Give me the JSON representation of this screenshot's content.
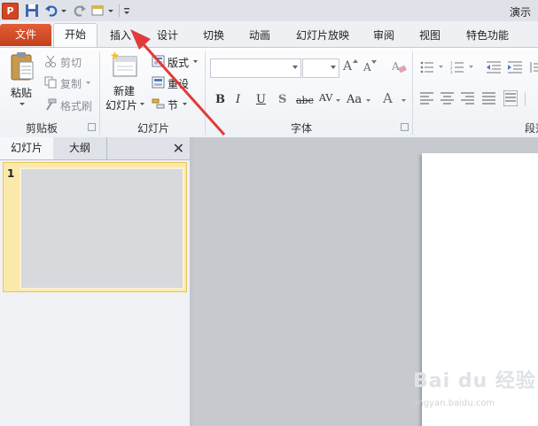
{
  "title_bar": {
    "app_logo": "P",
    "title": "演示"
  },
  "tabs": [
    "文件",
    "开始",
    "插入",
    "设计",
    "切换",
    "动画",
    "幻灯片放映",
    "审阅",
    "视图",
    "特色功能"
  ],
  "ribbon": {
    "clipboard": {
      "paste": "粘贴",
      "cut": "剪切",
      "copy": "复制",
      "format_painter": "格式刷",
      "label": "剪贴板"
    },
    "slides": {
      "new_slide_line1": "新建",
      "new_slide_line2": "幻灯片",
      "layout": "版式",
      "reset": "重设",
      "section": "节",
      "label": "幻灯片"
    },
    "font": {
      "font_name": "",
      "font_size": "",
      "bold": "B",
      "italic": "I",
      "underline": "U",
      "shadow": "S",
      "strike": "abc",
      "spacing": "AV",
      "case": "Aa",
      "color": "A",
      "grow": "A",
      "shrink": "A",
      "label": "字体"
    },
    "paragraph": {
      "label": "段落"
    }
  },
  "left_pane": {
    "tab_slides": "幻灯片",
    "tab_outline": "大纲",
    "close": "✕",
    "slide_number": "1"
  },
  "watermark": {
    "text": "Bai du 经验",
    "url": "jingyan.baidu.com"
  },
  "colors": {
    "file_tab": "#d24625",
    "annotation_arrow": "#e23a3a",
    "thumbnail_highlight": "#fbe9a9"
  }
}
